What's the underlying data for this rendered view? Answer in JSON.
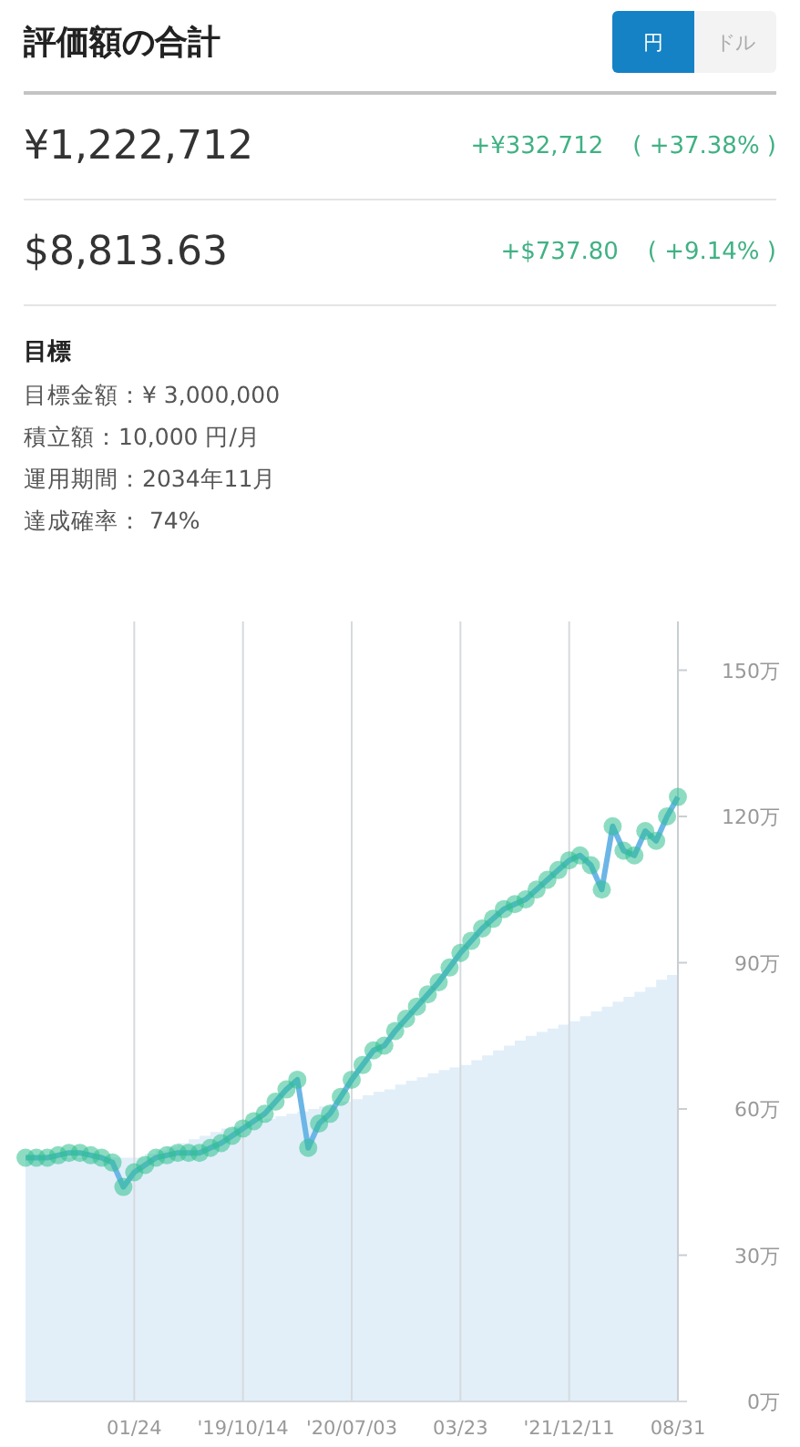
{
  "header": {
    "title": "評価額の合計",
    "currency_toggle": [
      {
        "label": "円",
        "selected": true
      },
      {
        "label": "ドル",
        "selected": false
      }
    ]
  },
  "totals": [
    {
      "amount": "¥1,222,712",
      "change": "+¥332,712",
      "percent": "( +37.38% )"
    },
    {
      "amount": "$8,813.63",
      "change": "+$737.80",
      "percent": "( +9.14% )"
    }
  ],
  "goal": {
    "title": "目標",
    "lines": [
      "目標金額：¥ 3,000,000",
      "積立額：10,000 円/月",
      "運用期間：2034年11月",
      "達成確率： 74%"
    ]
  },
  "chart": {
    "chart_data": {
      "type": "line",
      "grid": true,
      "categories": [
        null,
        null,
        null,
        null,
        null,
        null,
        null,
        null,
        null,
        null,
        "01/24",
        null,
        null,
        null,
        null,
        null,
        null,
        null,
        null,
        null,
        "'19/10/14",
        null,
        null,
        null,
        null,
        null,
        null,
        null,
        null,
        null,
        "'20/07/03",
        null,
        null,
        null,
        null,
        null,
        null,
        null,
        null,
        null,
        "03/23",
        null,
        null,
        null,
        null,
        null,
        null,
        null,
        null,
        null,
        "'21/12/11",
        null,
        null,
        null,
        null,
        null,
        null,
        null,
        null,
        null,
        "08/31"
      ],
      "series": [
        {
          "type": "area",
          "color": "#e2eff9",
          "values": [
            50,
            50,
            50,
            50,
            50,
            50,
            50,
            50,
            50,
            50,
            50,
            50.8,
            51.5,
            52.3,
            53,
            53.8,
            54.5,
            55.3,
            56,
            56.5,
            57,
            57.5,
            58,
            58.5,
            59,
            59.5,
            60,
            60.5,
            61,
            61.5,
            62,
            62.8,
            63.5,
            64,
            65,
            65.8,
            66.5,
            67.3,
            68,
            68.5,
            69,
            70,
            71,
            72,
            73,
            74,
            75,
            75.8,
            76.5,
            77.3,
            78,
            79,
            80,
            81,
            82,
            83,
            84,
            85,
            86.5,
            87.5,
            89
          ]
        },
        {
          "type": "line",
          "marker": "circle",
          "color": "#6cb6e6",
          "values": [
            50,
            50,
            50,
            50.5,
            51,
            51,
            50.5,
            50,
            49,
            44,
            47,
            48.5,
            50,
            50.5,
            51,
            51,
            51,
            52,
            53,
            54.5,
            56,
            57.5,
            59,
            61.5,
            64,
            66,
            52,
            57,
            59,
            62.5,
            66,
            69,
            72,
            73,
            76,
            78.5,
            81,
            83.5,
            86,
            89,
            92,
            94.5,
            97,
            99,
            101,
            102,
            103,
            105,
            107,
            109,
            111,
            112,
            110,
            105,
            118,
            113,
            112,
            117,
            115,
            120,
            124
          ]
        }
      ],
      "ylim": [
        0,
        160
      ],
      "yticks": [
        {
          "value": 0,
          "label": "0万"
        },
        {
          "value": 30,
          "label": "30万"
        },
        {
          "value": 60,
          "label": "60万"
        },
        {
          "value": 90,
          "label": "90万"
        },
        {
          "value": 120,
          "label": "120万"
        },
        {
          "value": 150,
          "label": "150万"
        }
      ]
    }
  }
}
